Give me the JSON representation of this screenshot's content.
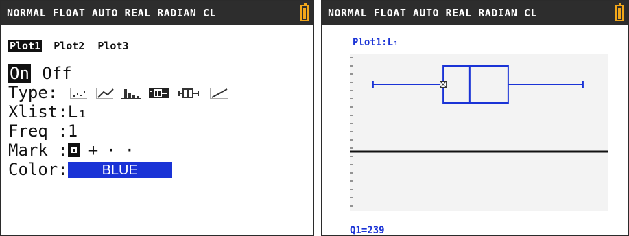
{
  "left_screen": {
    "status_text": "NORMAL FLOAT AUTO REAL RADIAN CL",
    "plot_tabs": [
      "Plot1",
      "Plot2",
      "Plot3"
    ],
    "selected_plot": "Plot1",
    "on_label": "On",
    "off_label": "Off",
    "selected_state": "On",
    "type_label": "Type:",
    "type_icons": [
      "scatter-plot-icon",
      "xy-line-plot-icon",
      "histogram-icon",
      "modified-boxplot-icon",
      "boxplot-icon",
      "normal-probability-plot-icon"
    ],
    "selected_type": "boxplot-icon",
    "xlist_label": "Xlist:",
    "xlist_value": "L₁",
    "freq_label": "Freq :",
    "freq_value": "1",
    "mark_label": "Mark :",
    "mark_options": [
      "□",
      "+",
      "·",
      "·"
    ],
    "color_label": "Color:",
    "color_value": "BLUE"
  },
  "right_screen": {
    "status_text": "NORMAL FLOAT AUTO REAL RADIAN CL",
    "plot_label": "Plot1:L₁",
    "trace_readout": "Q1=239",
    "boxplot": {
      "whisker_min_frac": 0.09,
      "q1_frac": 0.362,
      "median_frac": 0.465,
      "q3_frac": 0.614,
      "whisker_max_frac": 0.904,
      "trace_cursor": "Q1"
    },
    "colors": {
      "plot_color": "#1a33d6",
      "axis_color": "#111111"
    }
  }
}
